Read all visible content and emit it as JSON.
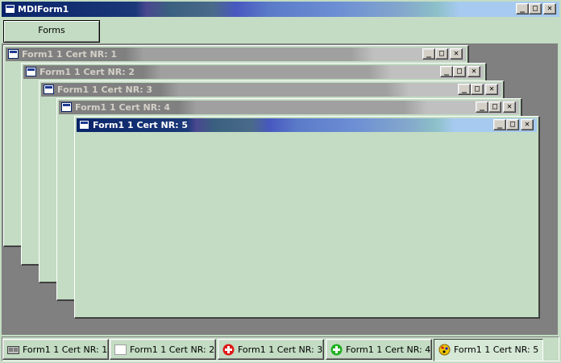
{
  "main": {
    "title": "MDIForm1",
    "toolbar": {
      "forms_label": "Forms"
    }
  },
  "caption_buttons": {
    "minimize": "_",
    "maximize": "□",
    "close": "✕"
  },
  "children": [
    {
      "title": "Form1 1 Cert NR: 1",
      "active": false
    },
    {
      "title": "Form1 1 Cert NR: 2",
      "active": false
    },
    {
      "title": "Form1 1 Cert NR: 3",
      "active": false
    },
    {
      "title": "Form1 1 Cert NR: 4",
      "active": false
    },
    {
      "title": "Form1 1 Cert NR: 5",
      "active": true
    }
  ],
  "taskbar": [
    {
      "label": "Form1 1 Cert NR: 1",
      "icon": "window-icon",
      "pressed": false
    },
    {
      "label": "Form1 1 Cert NR: 2",
      "icon": "blank-window-icon",
      "pressed": false
    },
    {
      "label": "Form1 1 Cert NR: 3",
      "icon": "red-plus-icon",
      "pressed": false
    },
    {
      "label": "Form1 1 Cert NR: 4",
      "icon": "green-plus-icon",
      "pressed": false
    },
    {
      "label": "Form1 1 Cert NR: 5",
      "icon": "certificate-seal-icon",
      "pressed": true
    }
  ],
  "colors": {
    "form_background": "#c3dcc3",
    "mdi_background": "#808080",
    "active_title_start": "#0a246a",
    "active_title_end": "#a6caf0"
  }
}
